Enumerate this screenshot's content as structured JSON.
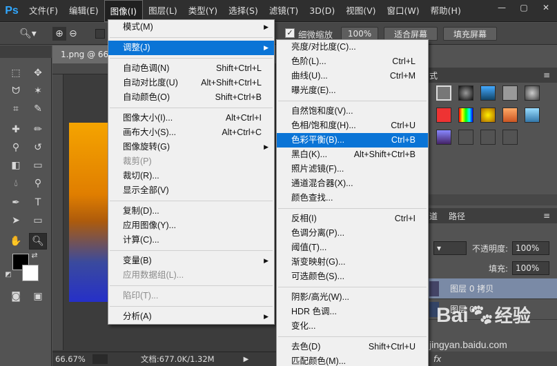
{
  "menubar": {
    "logo": "Ps",
    "items": [
      "文件(F)",
      "编辑(E)",
      "图像(I)",
      "图层(L)",
      "类型(Y)",
      "选择(S)",
      "滤镜(T)",
      "3D(D)",
      "视图(V)",
      "窗口(W)",
      "帮助(H)"
    ],
    "window_controls": [
      "—",
      "▢",
      "✕"
    ]
  },
  "options": {
    "checkbox_label": "细微缩放",
    "zoom_value": "100%",
    "fit_screen": "适合屏幕",
    "fill_screen": "填充屏幕"
  },
  "document": {
    "tab": "1.png @ 66.",
    "zoom": "66.67%",
    "doc_info": "文档:677.0K/1.32M"
  },
  "image_menu": [
    {
      "label": "模式(M)",
      "shortcut": "",
      "submenu": true
    },
    {
      "sep": true
    },
    {
      "label": "调整(J)",
      "shortcut": "",
      "submenu": true,
      "highlight": true
    },
    {
      "sep": true
    },
    {
      "label": "自动色调(N)",
      "shortcut": "Shift+Ctrl+L"
    },
    {
      "label": "自动对比度(U)",
      "shortcut": "Alt+Shift+Ctrl+L"
    },
    {
      "label": "自动颜色(O)",
      "shortcut": "Shift+Ctrl+B"
    },
    {
      "sep": true
    },
    {
      "label": "图像大小(I)...",
      "shortcut": "Alt+Ctrl+I"
    },
    {
      "label": "画布大小(S)...",
      "shortcut": "Alt+Ctrl+C"
    },
    {
      "label": "图像旋转(G)",
      "shortcut": "",
      "submenu": true
    },
    {
      "label": "裁剪(P)",
      "shortcut": "",
      "disabled": true
    },
    {
      "label": "裁切(R)...",
      "shortcut": ""
    },
    {
      "label": "显示全部(V)",
      "shortcut": ""
    },
    {
      "sep": true
    },
    {
      "label": "复制(D)...",
      "shortcut": ""
    },
    {
      "label": "应用图像(Y)...",
      "shortcut": ""
    },
    {
      "label": "计算(C)...",
      "shortcut": ""
    },
    {
      "sep": true
    },
    {
      "label": "变量(B)",
      "shortcut": "",
      "submenu": true
    },
    {
      "label": "应用数据组(L)...",
      "shortcut": "",
      "disabled": true
    },
    {
      "sep": true
    },
    {
      "label": "陷印(T)...",
      "shortcut": "",
      "disabled": true
    },
    {
      "sep": true
    },
    {
      "label": "分析(A)",
      "shortcut": "",
      "submenu": true
    }
  ],
  "adjust_menu": [
    {
      "label": "亮度/对比度(C)...",
      "shortcut": ""
    },
    {
      "label": "色阶(L)...",
      "shortcut": "Ctrl+L"
    },
    {
      "label": "曲线(U)...",
      "shortcut": "Ctrl+M"
    },
    {
      "label": "曝光度(E)...",
      "shortcut": ""
    },
    {
      "sep": true
    },
    {
      "label": "自然饱和度(V)...",
      "shortcut": ""
    },
    {
      "label": "色相/饱和度(H)...",
      "shortcut": "Ctrl+U"
    },
    {
      "label": "色彩平衡(B)...",
      "shortcut": "Ctrl+B",
      "highlight": true
    },
    {
      "label": "黑白(K)...",
      "shortcut": "Alt+Shift+Ctrl+B"
    },
    {
      "label": "照片滤镜(F)...",
      "shortcut": ""
    },
    {
      "label": "通道混合器(X)...",
      "shortcut": ""
    },
    {
      "label": "颜色查找...",
      "shortcut": ""
    },
    {
      "sep": true
    },
    {
      "label": "反相(I)",
      "shortcut": "Ctrl+I"
    },
    {
      "label": "色调分离(P)...",
      "shortcut": ""
    },
    {
      "label": "阈值(T)...",
      "shortcut": ""
    },
    {
      "label": "渐变映射(G)...",
      "shortcut": ""
    },
    {
      "label": "可选颜色(S)...",
      "shortcut": ""
    },
    {
      "sep": true
    },
    {
      "label": "阴影/高光(W)...",
      "shortcut": ""
    },
    {
      "label": "HDR 色调...",
      "shortcut": ""
    },
    {
      "label": "变化...",
      "shortcut": ""
    },
    {
      "sep": true
    },
    {
      "label": "去色(D)",
      "shortcut": "Shift+Ctrl+U"
    },
    {
      "label": "匹配颜色(M)...",
      "shortcut": ""
    }
  ],
  "panels": {
    "styles_tab_fragment": "式",
    "paths_tab": "路径",
    "tab_fragment": "道",
    "opacity_label": "不透明度:",
    "opacity_value": "100%",
    "fill_label": "填充:",
    "fill_value": "100%",
    "layers": [
      {
        "name": "图层 0 拷贝",
        "selected": true
      },
      {
        "name": "图层 0",
        "selected": false
      }
    ]
  },
  "watermark": {
    "brand": "Bai",
    "suffix": "经验",
    "url": "jingyan.baidu.com"
  },
  "colors": {
    "menu_highlight": "#0a74d6",
    "ps_blue": "#31a8ff"
  }
}
